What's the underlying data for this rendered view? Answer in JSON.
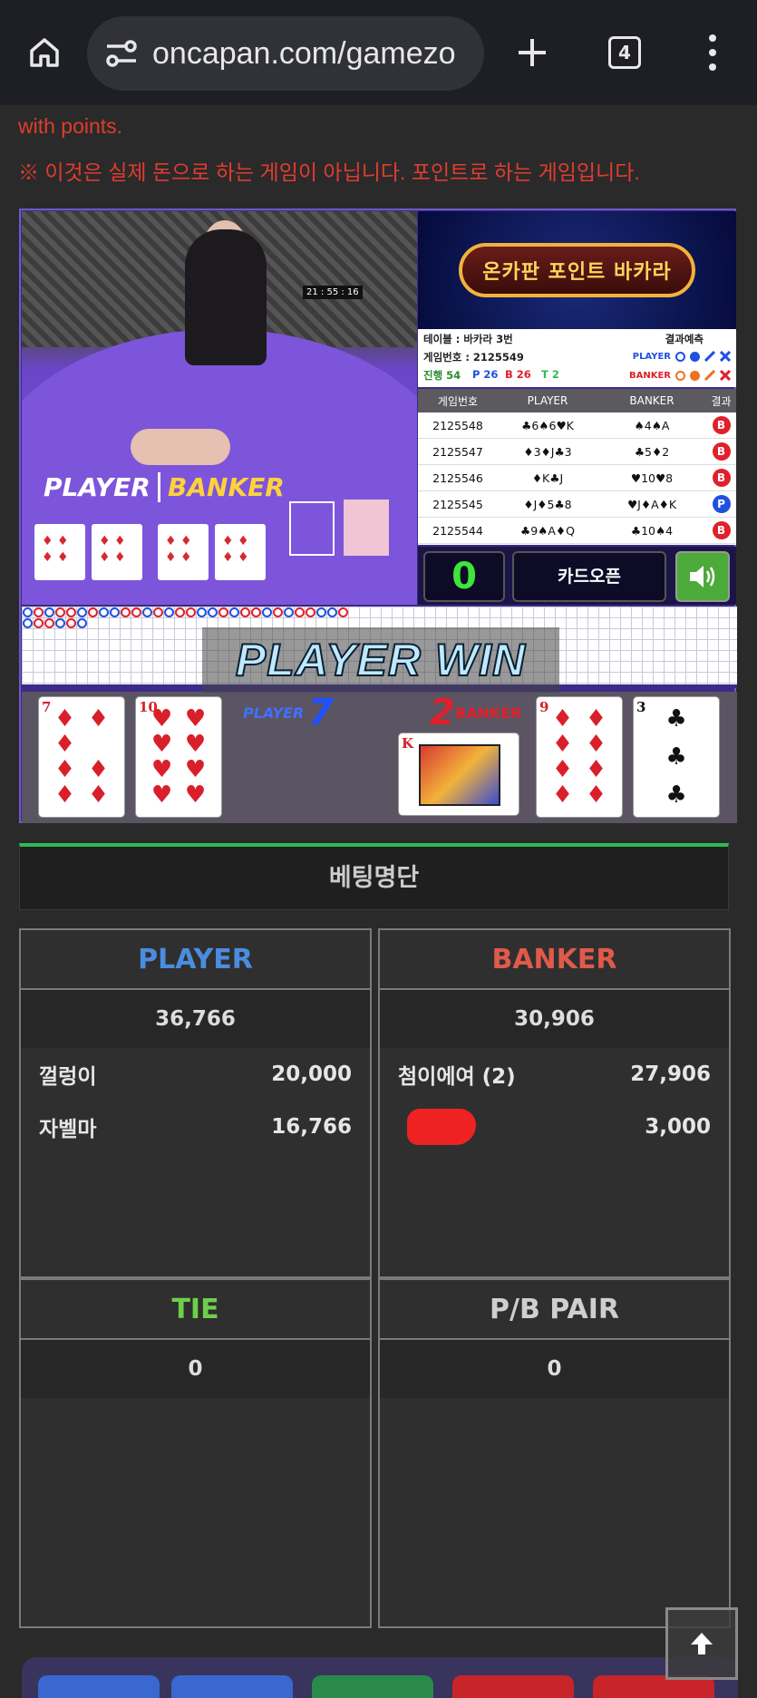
{
  "browser": {
    "url": "oncapan.com/gamezo",
    "tab_count": "4"
  },
  "notice": {
    "line1": "with points.",
    "line2": "※ 이것은 실제 돈으로 하는 게임이 아닙니다. 포인트로 하는 게임입니다."
  },
  "game": {
    "brand_title": "온카판 포인트 바카라",
    "video_clock": "21 : 55 : 16",
    "video_player_label": "PLAYER",
    "video_banker_label": "BANKER",
    "table_label": "테이블 : 바카라 3번",
    "game_no_label": "게임번호 : 2125549",
    "prediction_title": "결과예측",
    "prediction_player": "PLAYER",
    "prediction_banker": "BANKER",
    "progress_label": "진행 54",
    "p_count": "P 26",
    "b_count": "B 26",
    "t_count": "T 2",
    "history_headers": [
      "게임번호",
      "PLAYER",
      "BANKER",
      "결과"
    ],
    "history": [
      {
        "no": "2125548",
        "player": "♣6♠6♥K",
        "banker": "♠4♠A",
        "result": "B"
      },
      {
        "no": "2125547",
        "player": "♦3♦J♣3",
        "banker": "♣5♦2",
        "result": "B"
      },
      {
        "no": "2125546",
        "player": "♦K♣J",
        "banker": "♥10♥8",
        "result": "B"
      },
      {
        "no": "2125545",
        "player": "♦J♦5♣8",
        "banker": "♥J♦A♦K",
        "result": "P"
      },
      {
        "no": "2125544",
        "player": "♣9♠A♦Q",
        "banker": "♣10♠4",
        "result": "B"
      }
    ],
    "counter": "0",
    "card_open_label": "카드오픈",
    "win_banner": "PLAYER WIN",
    "player_label": "PLAYER",
    "player_total": "7",
    "banker_label": "BANKER",
    "banker_total": "2",
    "player_cards": [
      {
        "value": "7",
        "suit": "♦"
      },
      {
        "value": "10",
        "suit": "♥"
      }
    ],
    "banker_cards": [
      {
        "value": "K",
        "suit": "♦"
      },
      {
        "value": "9",
        "suit": "♦"
      },
      {
        "value": "3",
        "suit": "♣"
      }
    ],
    "colors": {
      "player": "#1f50e0",
      "banker": "#e0202a",
      "tie": "#2ebb55"
    }
  },
  "betting": {
    "header": "베팅명단",
    "player": {
      "title": "PLAYER",
      "total": "36,766",
      "entries": [
        {
          "name": "껄렁이",
          "amount": "20,000"
        },
        {
          "name": "자벨마",
          "amount": "16,766"
        }
      ]
    },
    "banker": {
      "title": "BANKER",
      "total": "30,906",
      "entries": [
        {
          "name": "첨이에여 (2)",
          "amount": "27,906"
        },
        {
          "name": "",
          "amount": "3,000"
        }
      ]
    },
    "tie": {
      "title": "TIE",
      "total": "0"
    },
    "pair": {
      "title": "P/B PAIR",
      "total": "0"
    }
  }
}
